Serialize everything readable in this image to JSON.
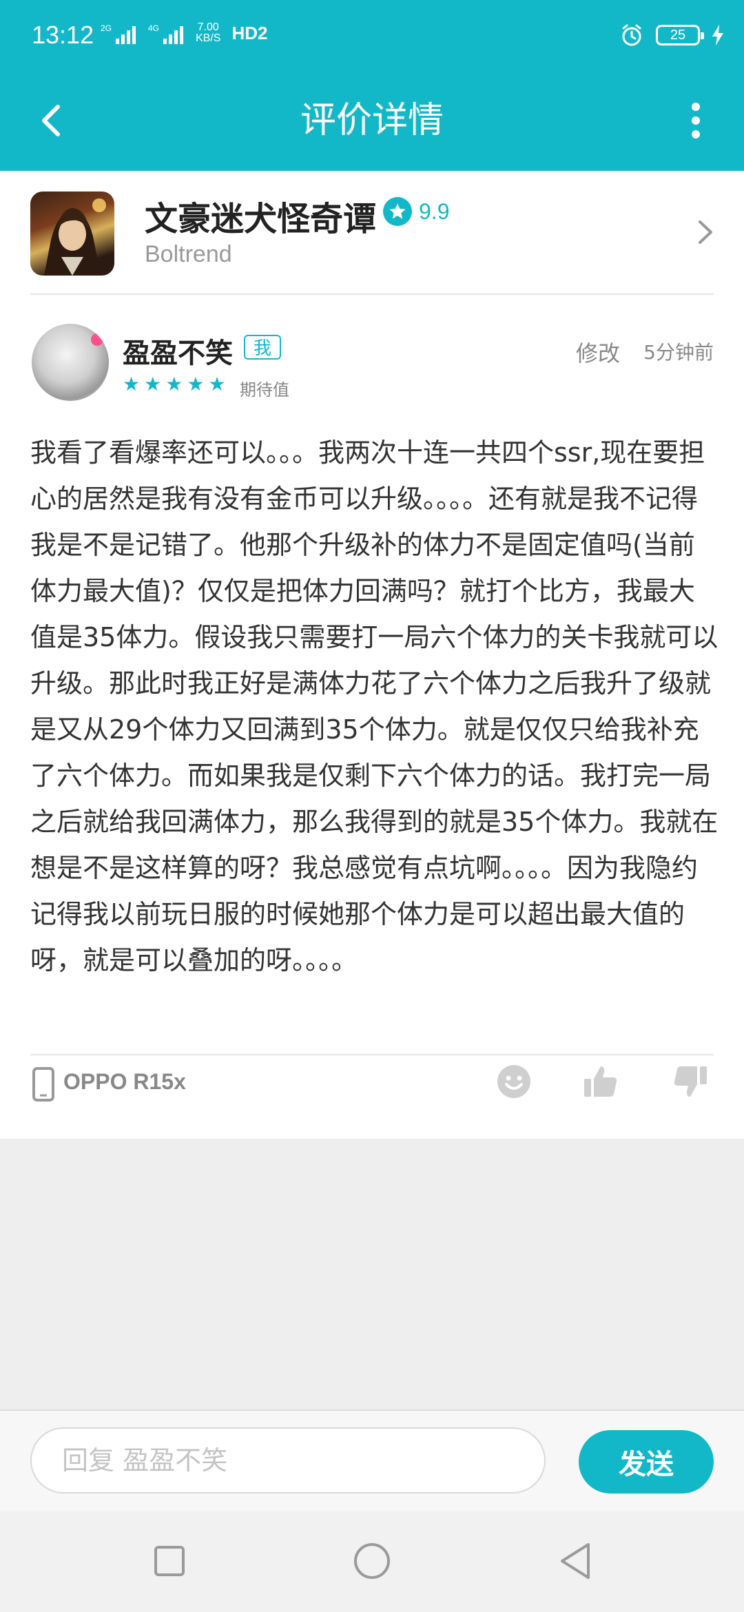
{
  "status_bar": {
    "time": "13:12",
    "signal1_label": "2G",
    "signal2_label": "4G",
    "speed_value": "7.00",
    "speed_unit": "KB/S",
    "hd_label": "HD2",
    "battery_level": "25"
  },
  "header": {
    "title": "评价详情",
    "back_icon": "chevron-left-icon",
    "more_icon": "more-vertical-icon"
  },
  "app": {
    "name": "文豪迷犬怪奇谭",
    "rating": "9.9",
    "developer": "Boltrend"
  },
  "review": {
    "username": "盈盈不笑",
    "me_badge": "我",
    "star_count": 5,
    "rating_label": "期待值",
    "edit_label": "修改",
    "time": "5分钟前",
    "body": "我看了看爆率还可以。。。我两次十连一共四个ssr,现在要担心的居然是我有没有金币可以升级。。。。还有就是我不记得我是不是记错了。他那个升级补的体力不是固定值吗(当前体力最大值)？仅仅是把体力回满吗？就打个比方，我最大值是35体力。假设我只需要打一局六个体力的关卡我就可以升级。那此时我正好是满体力花了六个体力之后我升了级就是又从29个体力又回满到35个体力。就是仅仅只给我补充了六个体力。而如果我是仅剩下六个体力的话。我打完一局之后就给我回满体力，那么我得到的就是35个体力。我就在想是不是这样算的呀？我总感觉有点坑啊。。。。因为我隐约记得我以前玩日服的时候她那个体力是可以超出最大值的呀，就是可以叠加的呀。。。。",
    "device": "OPPO R15x"
  },
  "reply": {
    "placeholder": "回复 盈盈不笑",
    "send_label": "发送"
  },
  "colors": {
    "accent": "#13b8c8",
    "background": "#eeeeee"
  }
}
